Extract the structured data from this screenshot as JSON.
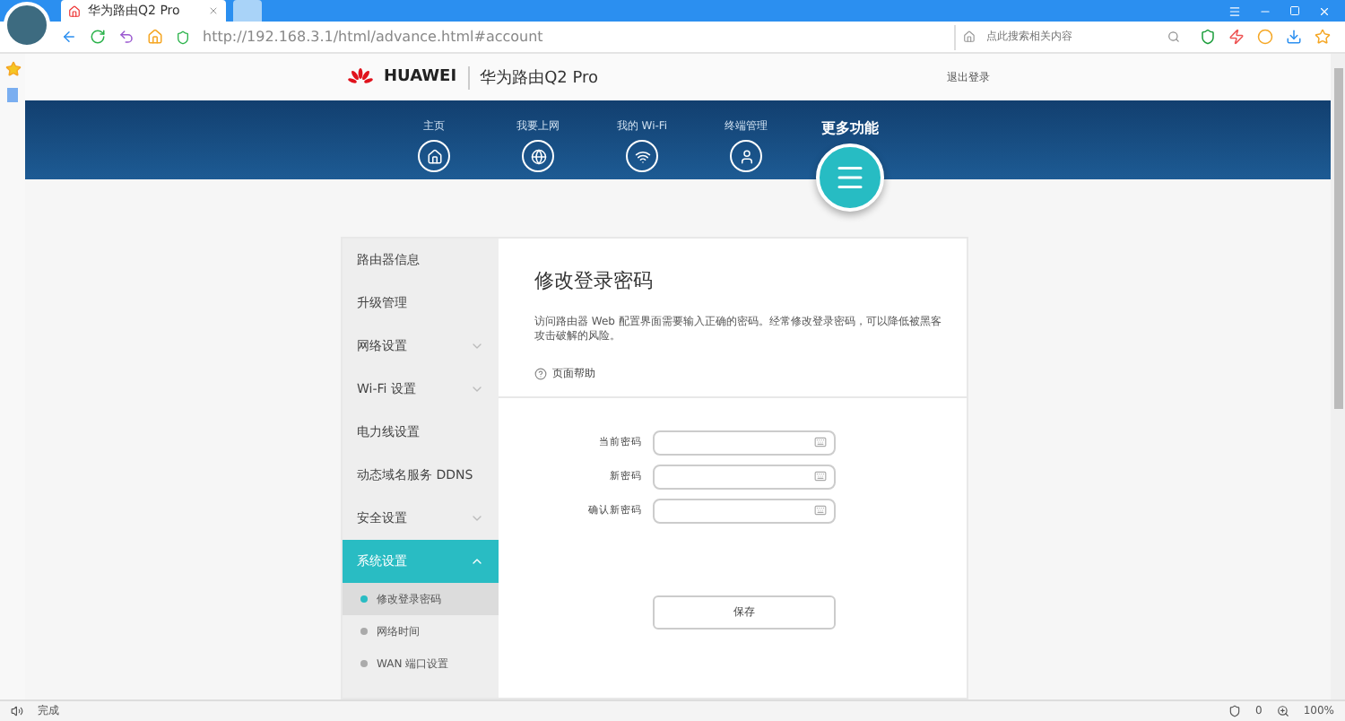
{
  "browser": {
    "tabs": [
      {
        "title": "华为路由Q2 Pro",
        "selected": true
      }
    ],
    "url": "http://192.168.3.1/html/advance.html#account",
    "search": {
      "placeholder": "点此搜索相关内容"
    }
  },
  "header": {
    "brand": "HUAWEI",
    "product": "华为路由Q2 Pro",
    "logout": "退出登录"
  },
  "nav": [
    {
      "label": "主页",
      "selected": false
    },
    {
      "label": "我要上网",
      "selected": false
    },
    {
      "label": "我的 Wi-Fi",
      "selected": false
    },
    {
      "label": "终端管理",
      "selected": false
    },
    {
      "label": "更多功能",
      "selected": true
    }
  ],
  "sidebar": {
    "items": [
      {
        "label": "路由器信息",
        "kind": "link",
        "selected": false
      },
      {
        "label": "升级管理",
        "kind": "link",
        "selected": false
      },
      {
        "label": "网络设置",
        "kind": "group",
        "expanded": false,
        "selected": false
      },
      {
        "label": "Wi-Fi 设置",
        "kind": "group",
        "expanded": false,
        "selected": false
      },
      {
        "label": "电力线设置",
        "kind": "link",
        "selected": false
      },
      {
        "label": "动态域名服务 DDNS",
        "kind": "link",
        "selected": false
      },
      {
        "label": "安全设置",
        "kind": "group",
        "expanded": false,
        "selected": false
      },
      {
        "label": "系统设置",
        "kind": "group",
        "expanded": true,
        "selected": true,
        "children": [
          {
            "label": "修改登录密码",
            "selected": true
          },
          {
            "label": "网络时间",
            "selected": false
          },
          {
            "label": "WAN 端口设置",
            "selected": false
          }
        ]
      }
    ]
  },
  "content": {
    "title": "修改登录密码",
    "description": "访问路由器 Web 配置界面需要输入正确的密码。经常修改登录密码，可以降低被黑客攻击破解的风险。",
    "help": "页面帮助",
    "fields": [
      {
        "label": "当前密码"
      },
      {
        "label": "新密码"
      },
      {
        "label": "确认新密码"
      }
    ],
    "save": "保存"
  },
  "status_bar": {
    "text": "完成",
    "count": "0",
    "zoom": "100%"
  }
}
